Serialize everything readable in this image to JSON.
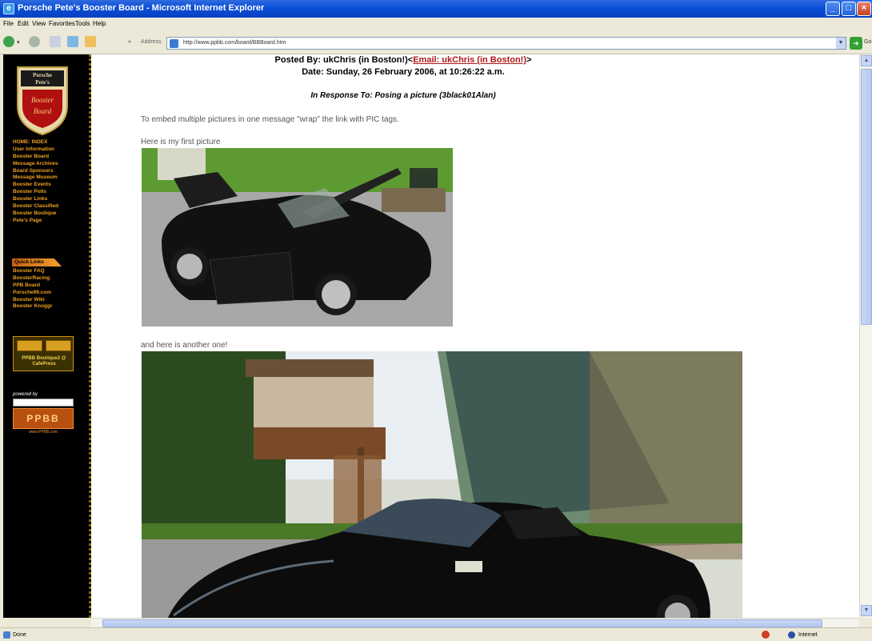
{
  "window": {
    "title": "Porsche Pete's Booster Board - Microsoft Internet Explorer"
  },
  "menu": [
    "File",
    "Edit",
    "View",
    "Favorites",
    "Tools",
    "Help"
  ],
  "toolbar": {
    "address_label": "Address",
    "url": "http://www.ppbb.com/board/BBBoard.htm",
    "go_label": "Go"
  },
  "sidebar": {
    "logo_text": [
      "Porsche",
      "Pete's",
      "Booster",
      "Board"
    ],
    "nav_items": [
      "HOME: INDEX",
      "User Information",
      "Booster Board",
      "Message Archives",
      "Board Sponsors",
      "Message Museum",
      "Booster Events",
      "Booster Polls",
      "Booster Links",
      "Booster Classified",
      "Booster Boutique",
      "Pete's Page"
    ],
    "quick_links_label": "Quick Links",
    "quick_links": [
      "Booster FAQ",
      "BoosterRacing",
      "PPB Board",
      "Porsche99.com",
      "Booster Wiki",
      "Booster Knoggr"
    ],
    "boutique_banner": "PPBB Boutique2 @ CafePress",
    "powered_by": "powered by",
    "ppbb_logo": "PPBB",
    "ppbb_url": "www.PPBB.com"
  },
  "post": {
    "posted_by_label": "Posted By: ukChris (in Boston!)",
    "email_link": "Email: ukChris (in Boston!)",
    "date": "Date: Sunday, 26 February 2006, at 10:26:22 a.m.",
    "in_response": "In Response To: Posing a picture (3black01Alan)",
    "intro": "To embed multiple pictures in one message \"wrap\" the link with PIC tags.",
    "caption1": "Here is my first picture",
    "caption2": "and here is another one!"
  },
  "status": {
    "text": "Done",
    "zone": "Internet"
  }
}
